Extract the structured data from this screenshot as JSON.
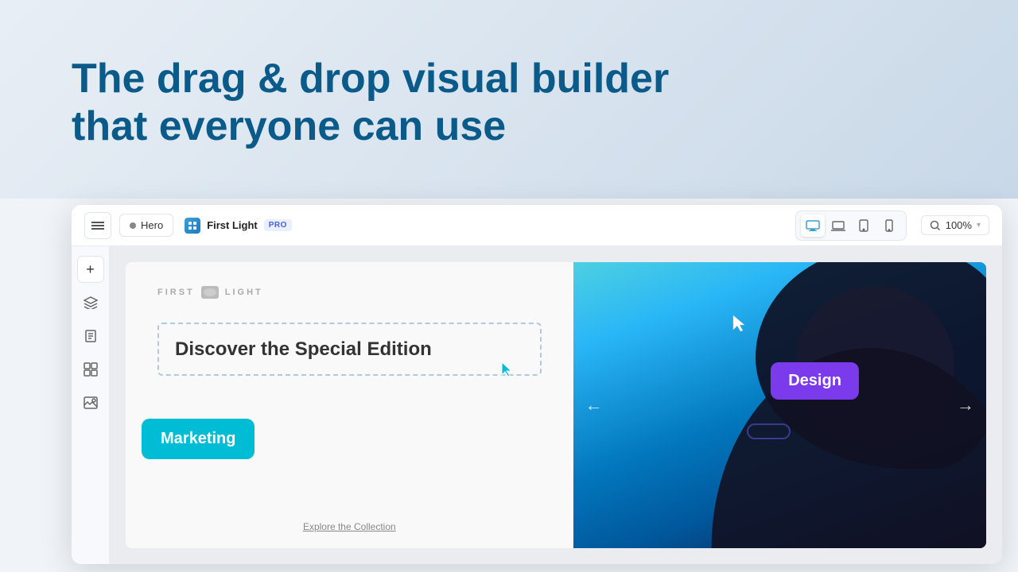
{
  "page": {
    "heading_line1": "The drag & drop visual builder",
    "heading_line2": "that everyone can use"
  },
  "toolbar": {
    "menu_icon": "≡",
    "tab_label": "Hero",
    "project_name": "First Light",
    "pro_badge": "PRO",
    "zoom": "100%",
    "zoom_icon": "🔍",
    "devices": [
      {
        "id": "desktop",
        "label": "Desktop",
        "active": true
      },
      {
        "id": "laptop",
        "label": "Laptop",
        "active": false
      },
      {
        "id": "tablet",
        "label": "Tablet",
        "active": false
      },
      {
        "id": "mobile",
        "label": "Mobile",
        "active": false
      }
    ]
  },
  "sidebar": {
    "buttons": [
      {
        "id": "add",
        "icon": "+",
        "label": "Add element"
      },
      {
        "id": "layers",
        "icon": "⊞",
        "label": "Layers"
      },
      {
        "id": "pages",
        "icon": "☰",
        "label": "Pages"
      },
      {
        "id": "blocks",
        "icon": "⊟",
        "label": "Blocks"
      },
      {
        "id": "media",
        "icon": "⊡",
        "label": "Media"
      }
    ]
  },
  "canvas": {
    "brand_name": "FIRST LIGHT",
    "headline": "Discover the Special Edition",
    "explore_link": "Explore the Collection",
    "marketing_badge": "Marketing",
    "design_badge": "Design"
  },
  "colors": {
    "heading_blue": "#0a5a8a",
    "teal": "#00bcd4",
    "purple": "#7c3aed",
    "pro_bg": "#e8f0fe",
    "pro_color": "#4a5fd4"
  }
}
